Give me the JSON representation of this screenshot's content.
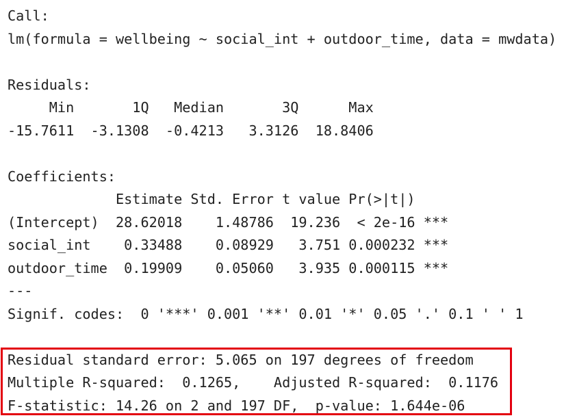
{
  "output_lines": [
    "Call:",
    "lm(formula = wellbeing ~ social_int + outdoor_time, data = mwdata)",
    "",
    "Residuals:",
    "     Min       1Q   Median       3Q      Max ",
    "-15.7611  -3.1308  -0.4213   3.3126  18.8406 ",
    "",
    "Coefficients:",
    "             Estimate Std. Error t value Pr(>|t|)    ",
    "(Intercept)  28.62018    1.48786  19.236  < 2e-16 ***",
    "social_int    0.33488    0.08929   3.751 0.000232 ***",
    "outdoor_time  0.19909    0.05060   3.935 0.000115 ***",
    "---",
    "Signif. codes:  0 '***' 0.001 '**' 0.01 '*' 0.05 '.' 0.1 ' ' 1",
    "",
    "Residual standard error: 5.065 on 197 degrees of freedom",
    "Multiple R-squared:  0.1265,\tAdjusted R-squared:  0.1176 ",
    "F-statistic: 14.26 on 2 and 197 DF,  p-value: 1.644e-06"
  ],
  "colors": {
    "highlight_border": "#e3000f",
    "text": "#222222",
    "background": "#ffffff"
  }
}
